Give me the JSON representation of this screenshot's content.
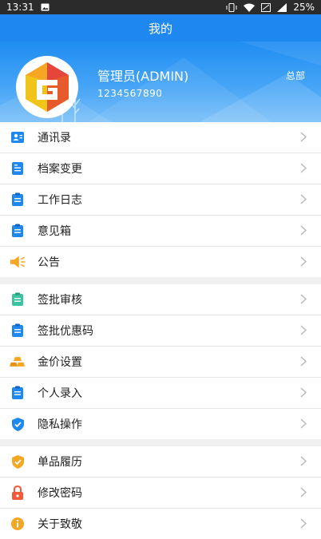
{
  "status_bar": {
    "time": "13:31",
    "battery": "25%"
  },
  "header": {
    "title": "我的"
  },
  "profile": {
    "name": "管理员(ADMIN)",
    "id": "1234567890",
    "dept": "总部"
  },
  "menu": {
    "group1": [
      {
        "label": "通讯录",
        "icon": "contacts-icon",
        "color": "#1e88f0"
      },
      {
        "label": "档案变更",
        "icon": "archive-icon",
        "color": "#1e88f0"
      },
      {
        "label": "工作日志",
        "icon": "clipboard-icon",
        "color": "#1e88f0"
      },
      {
        "label": "意见箱",
        "icon": "clipboard-icon",
        "color": "#1e88f0"
      },
      {
        "label": "公告",
        "icon": "megaphone-icon",
        "color": "#f5a623"
      }
    ],
    "group2": [
      {
        "label": "签批审核",
        "icon": "clipboard-icon",
        "color": "#3cc3a0"
      },
      {
        "label": "签批优惠码",
        "icon": "clipboard-icon",
        "color": "#1e88f0"
      },
      {
        "label": "金价设置",
        "icon": "gold-icon",
        "color": "#f5a623"
      },
      {
        "label": "个人录入",
        "icon": "clipboard-icon",
        "color": "#1e88f0"
      },
      {
        "label": "隐私操作",
        "icon": "shield-icon",
        "color": "#1e88f0"
      }
    ],
    "group3": [
      {
        "label": "单品履历",
        "icon": "shield-check-icon",
        "color": "#f5a623"
      },
      {
        "label": "修改密码",
        "icon": "lock-icon",
        "color": "#f25b3a"
      },
      {
        "label": "关于致敬",
        "icon": "info-icon",
        "color": "#f5a623"
      }
    ]
  },
  "colors": {
    "primary": "#1e88f0",
    "accent_orange": "#f5a623",
    "accent_green": "#3cc3a0",
    "accent_red": "#f25b3a"
  }
}
